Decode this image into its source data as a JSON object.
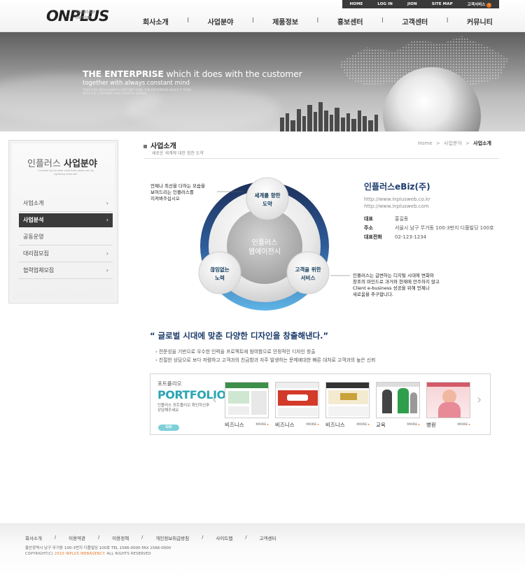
{
  "header": {
    "logo_text": "ONPLUS",
    "logo_tagline": "creative design",
    "util": [
      "HOME",
      "LOG IN",
      "JION",
      "SITE MAP",
      "고객서비스"
    ],
    "gnb": [
      "회사소개",
      "사업분야",
      "제품정보",
      "홍보센터",
      "고객센터",
      "커뮤니티"
    ],
    "gnb_separator": "l"
  },
  "hero": {
    "title_strong": "THE ENTERPRISE",
    "title_rest": " which it does with the customer",
    "subtitle": "together with always constant mind",
    "small_text": "TOGETHER WITH ALWAYS CONSTANT MIND. THE ENTERPRISE WHICH IT DOES WITH THE CUSTOMER AND CREATIVE DESIGN"
  },
  "lnb": {
    "title_light": "인플러스",
    "title_bold": "사업분야",
    "caption": "If should say to wear solid from above you as lightning show hair",
    "items": [
      {
        "label": "사업소개",
        "chevron": "›",
        "active": false
      },
      {
        "label": "사업분석",
        "chevron": "›",
        "active": true
      },
      {
        "label": "공동운영",
        "chevron": "",
        "active": false
      },
      {
        "label": "대리점모집",
        "chevron": "›",
        "active": false
      },
      {
        "label": "협력업체모집",
        "chevron": "›",
        "active": false
      }
    ]
  },
  "content": {
    "title": "사업소개",
    "subtitle": "새로운 세계에 대한 힘찬 도약",
    "breadcrumb": [
      "Home",
      "사업분야",
      "사업소개"
    ],
    "breadcrumb_sep": ">"
  },
  "diagram": {
    "center": [
      "인플러스",
      "웹에이전시"
    ],
    "node_top": [
      "세계를 향한",
      "도약"
    ],
    "node_left": [
      "끊임없는",
      "노력"
    ],
    "node_right": [
      "고객을 위한",
      "서비스"
    ],
    "note_left": [
      "언제나 최선을 다하는 모습을",
      "보여드리는 인플러스를",
      "지켜봐주십시오"
    ],
    "note_right": [
      "인플러스는 급변하는 디지털 시대에 변화와",
      "창조의 마인드로 과거와 현재에 안주하지 않고",
      "Client e-business 성공을 위해 언제나",
      "새로움을 추구합니다."
    ]
  },
  "company": {
    "name": "인플러스eBiz(주)",
    "urls": [
      "http://www.inpiusweb.co.kr",
      "http://www.inplusweb.com"
    ],
    "info": [
      {
        "key": "대표",
        "value": "홍길동"
      },
      {
        "key": "주소",
        "value": "서울시 남구 무거동 100-3번지 디플빌딩 100호"
      },
      {
        "key": "대표전화",
        "value": "02-123-1234"
      }
    ]
  },
  "slogan": {
    "headline": "“ 글로벌 시대에 맞춘 다양한 디자인을 창출해낸다.”",
    "line1": "› 전문성을 기반으로 우수한 인력을 프로젝트에 참여함으로 안정적인 디자인 창출",
    "line2": "› 친절한 상담으로 보다 저렴하고 고객과의 친금함과 자주 발생하는 문제에대한 빠른 대처로 고객과의 높은 신뢰"
  },
  "portfolio": {
    "label": "포트폴리오",
    "title": "PORTFOLIO",
    "desc": "인플러스 포트폴리오 확인하신후 상담해주세요",
    "go": "GO",
    "prev": "‹",
    "next": "›",
    "more": "MORE",
    "items": [
      {
        "category": "비즈니스",
        "accent": "#3d8f4a"
      },
      {
        "category": "비즈니스",
        "accent": "#d23a2a"
      },
      {
        "category": "비즈니스",
        "accent": "#c9a23a"
      },
      {
        "category": "교육",
        "accent": "#2e9e4a"
      },
      {
        "category": "병원",
        "accent": "#d45a6a"
      }
    ]
  },
  "footer": {
    "nav": [
      "회사소개",
      "이용약관",
      "이용정책",
      "개인정보취급방침",
      "사이트맵",
      "고객센터"
    ],
    "nav_sep": "/",
    "address": "울산광역시 남구 무거동 100-3번지 디플빌딩 100호   TEL 1566-0000     FAX 1566-0000",
    "copy_prefix": "COPYRIGHT(C) ",
    "copy_highlight": "2010 INPLUS WEBAGENCY.",
    "copy_suffix": " ALL RIGHTS RESERVED"
  },
  "colors": {
    "brand_navy": "#1d3c6e",
    "accent_teal": "#2aa5b3",
    "accent_orange": "#e8741c",
    "ring_blue": "#3a8fd0"
  }
}
